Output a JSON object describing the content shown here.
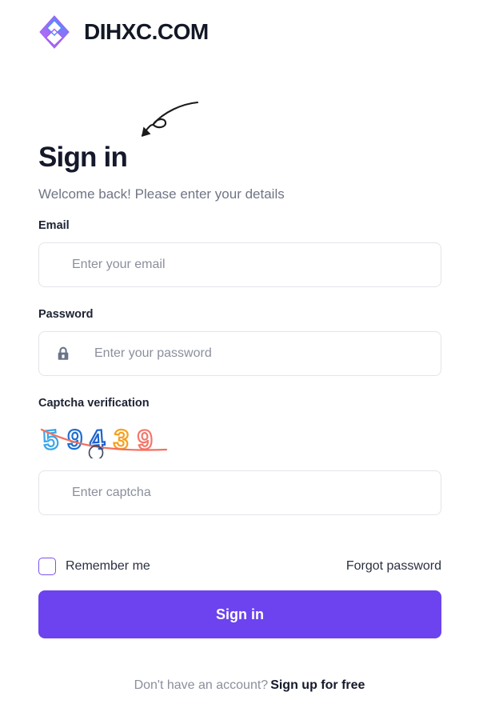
{
  "brand": {
    "name": "DIHXC.COM",
    "logo_icon": "diamond-logo-icon",
    "logo_gradient_from": "#b46cf0",
    "logo_gradient_to": "#4f7bff"
  },
  "decoration": {
    "arrow_icon": "curved-arrow-doodle-icon",
    "arrow_color": "#1b1b1b"
  },
  "heading": {
    "title": "Sign in",
    "subtitle": "Welcome back! Please enter your details"
  },
  "form": {
    "email": {
      "label": "Email",
      "placeholder": "Enter your email",
      "value": ""
    },
    "password": {
      "label": "Password",
      "placeholder": "Enter your password",
      "value": "",
      "icon": "lock-icon",
      "icon_color": "#6b7487"
    },
    "captcha": {
      "label": "Captcha verification",
      "placeholder": "Enter captcha",
      "value": "",
      "image_code": "59439",
      "digits": [
        {
          "char": "5",
          "color": "#3aa6e8"
        },
        {
          "char": "9",
          "color": "#1d6fd0"
        },
        {
          "char": "4",
          "color": "#1f63cf"
        },
        {
          "char": "3",
          "color": "#f6a01f"
        },
        {
          "char": "9",
          "color": "#f4776b"
        }
      ],
      "noise_line_color": "#f4705e",
      "noise_circle_color": "#3c4458"
    }
  },
  "options": {
    "remember_label": "Remember me",
    "remember_checked": false,
    "checkbox_color": "#7b52f0",
    "forgot_label": "Forgot password"
  },
  "actions": {
    "submit_label": "Sign in",
    "submit_color": "#6c43ef"
  },
  "footer": {
    "prompt": "Don't have an account?",
    "link_label": "Sign up for free"
  }
}
